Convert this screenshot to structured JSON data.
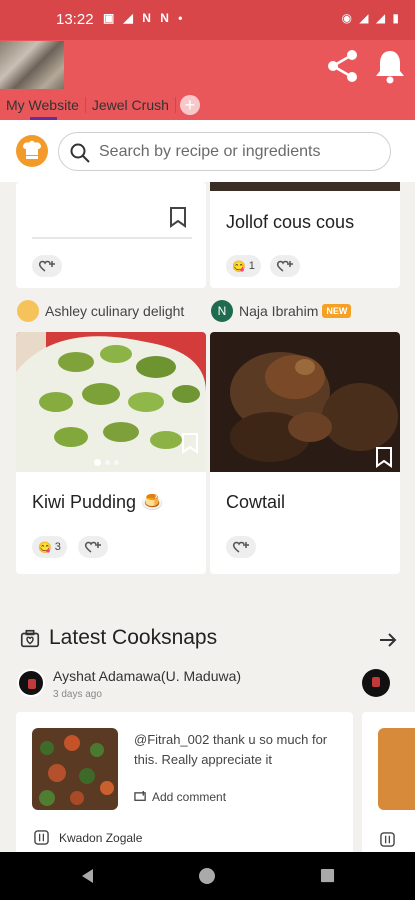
{
  "status_bar": {
    "time": "13:22",
    "left_icons": "▣ ◢ N N •",
    "right_icons": "◉ ◢ ◢ ▮"
  },
  "header": {
    "tabs": [
      {
        "label": "My Website",
        "active": true
      },
      {
        "label": "Jewel Crush",
        "active": false
      }
    ],
    "add_tab": "+"
  },
  "search": {
    "placeholder": "Search by recipe or ingredients"
  },
  "feed": {
    "top_right_title": "Jollof cous cous",
    "top_right_reaction_count": "1",
    "card_left": {
      "author": "Ashley culinary delight",
      "title": "Kiwi Pudding 🍮",
      "reaction_count": "3"
    },
    "card_right": {
      "author": "Naja Ibrahim",
      "author_initial": "N",
      "badge": "NEW",
      "title": "Cowtail"
    }
  },
  "cooksnaps": {
    "section_title": "Latest Cooksnaps",
    "user": "Ayshat Adamawa(U. Maduwa)",
    "time": "3 days ago",
    "comment": "@Fitrah_002 thank u so much for this. Really appreciate it",
    "add_comment": "Add comment",
    "recipe": "Kwadon Zogale"
  },
  "colors": {
    "status_bar": "#d8464a",
    "header": "#e9575b",
    "accent": "#f39b2a",
    "tab_indicator": "#6a2aa0"
  }
}
